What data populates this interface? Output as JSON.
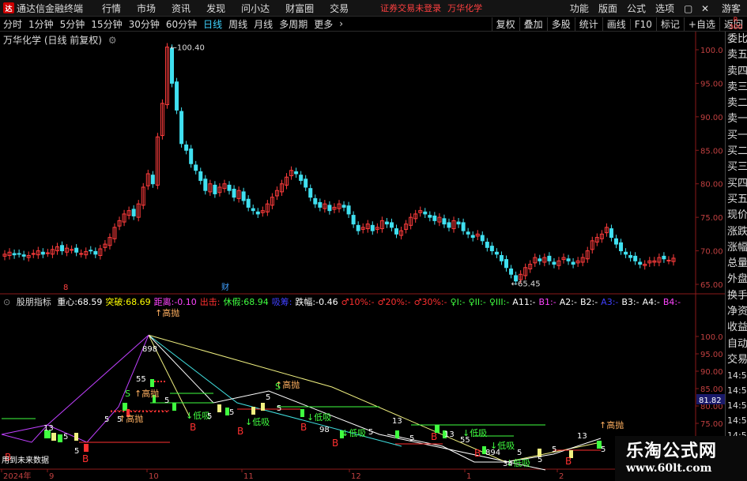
{
  "app": {
    "title": "通达信金融终端",
    "menu": [
      "行情",
      "市场",
      "资讯",
      "发现",
      "问小达",
      "财富圈",
      "交易"
    ],
    "status": "证券交易未登录",
    "stock_name": "万华化学",
    "right_menu": [
      "功能",
      "版面",
      "公式",
      "选项",
      "游客"
    ],
    "corner_badge": "R\n300"
  },
  "toolbar": {
    "periods": [
      "分时",
      "1分钟",
      "5分钟",
      "15分钟",
      "30分钟",
      "60分钟",
      "日线",
      "周线",
      "月线",
      "多周期",
      "更多"
    ],
    "active_period": "日线",
    "tools": [
      "复权",
      "叠加",
      "多股",
      "统计",
      "画线",
      "F10",
      "标记",
      "+自选",
      "返回"
    ]
  },
  "main_chart": {
    "title": "万华化学 (日线 前复权)",
    "y_ticks": [
      "100.0",
      "95.00",
      "90.00",
      "85.00",
      "80.00",
      "75.00",
      "70.00",
      "65.00"
    ],
    "high_label": "100.40",
    "low_label": "65.45",
    "markers": [
      "8",
      "财"
    ]
  },
  "indicator": {
    "name": "股朋指标",
    "items": [
      {
        "label": "重心:",
        "value": "68.59",
        "color": "#ffffff"
      },
      {
        "label": "突破:",
        "value": "68.69",
        "color": "#ffff00"
      },
      {
        "label": "距离:",
        "value": "-0.10",
        "color": "#ff44ff"
      },
      {
        "label": "出击:",
        "value": "",
        "color": "#ff3030"
      },
      {
        "label": "休假:",
        "value": "68.94",
        "color": "#40ff40"
      },
      {
        "label": "吸筹:",
        "value": "",
        "color": "#4040ff"
      },
      {
        "label": "跌幅:",
        "value": "-0.46",
        "color": "#ffffff"
      },
      {
        "label": "♂10%:",
        "value": "-",
        "color": "#ff3030"
      },
      {
        "label": "♂20%:",
        "value": "-",
        "color": "#ff3030"
      },
      {
        "label": "♂30%:",
        "value": "-",
        "color": "#ff3030"
      },
      {
        "label": "♀I:",
        "value": "-",
        "color": "#40ff40"
      },
      {
        "label": "♀II:",
        "value": "-",
        "color": "#40ff40"
      },
      {
        "label": "♀III:",
        "value": "-",
        "color": "#40ff40"
      },
      {
        "label": "A11:",
        "value": "-",
        "color": "#ffffff"
      },
      {
        "label": "B1:",
        "value": "-",
        "color": "#ff44ff"
      },
      {
        "label": "A2:",
        "value": "-",
        "color": "#ffffff"
      },
      {
        "label": "B2:",
        "value": "-",
        "color": "#ffffff"
      },
      {
        "label": "A3:",
        "value": "-",
        "color": "#4040ff"
      },
      {
        "label": "B3:",
        "value": "-",
        "color": "#ffffff"
      },
      {
        "label": "A4:",
        "value": "-",
        "color": "#ffffff"
      },
      {
        "label": "B4:",
        "value": "-",
        "color": "#ff44ff"
      }
    ],
    "y_ticks": [
      "100.0",
      "95.00",
      "90.00",
      "85.00",
      "80.00",
      "75.00"
    ],
    "current_value": "81.82",
    "future_note": "用到未来数据",
    "labels": {
      "high_sell": "高抛",
      "low_buy": "低吸",
      "buy": "B",
      "sell": "S"
    }
  },
  "x_axis": [
    "2024年",
    "9",
    "10",
    "11",
    "12",
    "1",
    "2"
  ],
  "side_panel": [
    "委比",
    "卖五",
    "卖四",
    "卖三",
    "卖二",
    "卖一",
    "买一",
    "买二",
    "买三",
    "买四",
    "买五",
    "现价",
    "涨跌",
    "涨幅",
    "总量",
    "外盘",
    "换手",
    "净资",
    "收益",
    "自动",
    "交易",
    "14:56",
    "14:56",
    "14:56",
    "14:56",
    "14:56",
    "14:56",
    "14:56",
    "14:56"
  ],
  "watermark": {
    "title": "乐淘公式网",
    "url": "www.60lt.com"
  },
  "colors": {
    "up": "#ff3c3c",
    "down": "#40e0f0",
    "axis": "#8b1a1a",
    "grid": "#2a0808"
  }
}
